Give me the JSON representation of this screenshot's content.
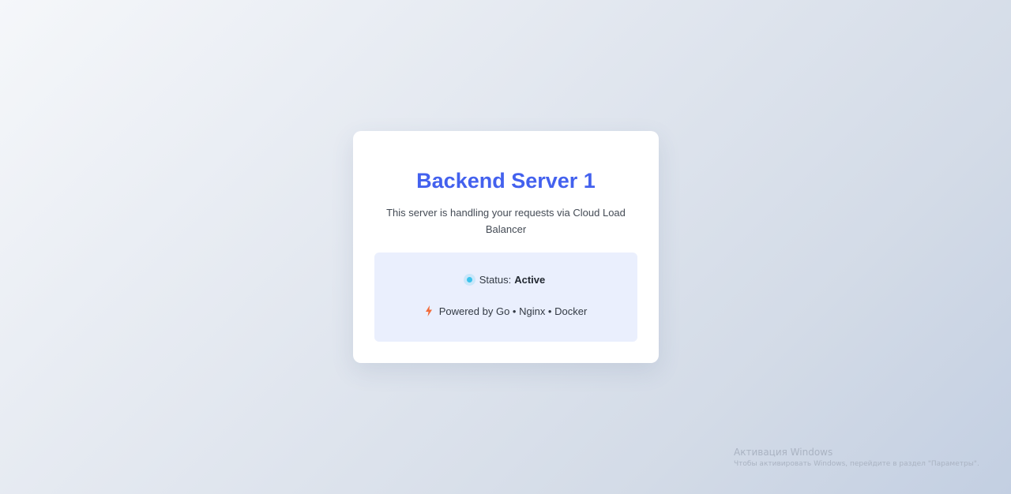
{
  "card": {
    "title": "Backend Server 1",
    "description": "This server is handling your requests via Cloud Load Balancer"
  },
  "status": {
    "label": "Status:",
    "value": "Active",
    "icon": "status-dot-icon",
    "color": "#3cc3ec"
  },
  "powered": {
    "icon": "lightning-bolt-icon",
    "text": "Powered by Go • Nginx • Docker",
    "icon_color": "#f26b3a"
  },
  "watermark": {
    "title": "Активация Windows",
    "subtitle": "Чтобы активировать Windows, перейдите в раздел \"Параметры\"."
  },
  "colors": {
    "accent": "#4361ee",
    "info_box_bg": "#eaeffd",
    "card_bg": "#ffffff"
  }
}
